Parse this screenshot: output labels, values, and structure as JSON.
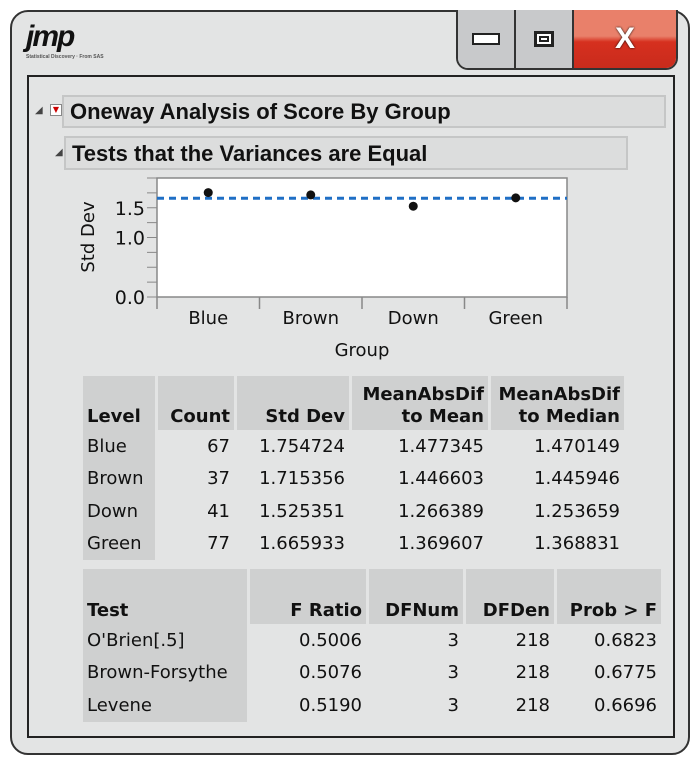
{
  "window": {
    "logo": "jmp",
    "logo_tagline": "Statistical Discovery · From SAS",
    "minimize": "minimize",
    "maximize": "maximize",
    "close": "X"
  },
  "outline": {
    "title": "Oneway Analysis of Score By Group",
    "subtitle": "Tests that the Variances are Equal"
  },
  "chart_data": {
    "type": "scatter",
    "xlabel": "Group",
    "ylabel": "Std Dev",
    "categories": [
      "Blue",
      "Brown",
      "Down",
      "Green"
    ],
    "values": [
      1.754724,
      1.715356,
      1.525351,
      1.665933
    ],
    "ylim": [
      0,
      2
    ],
    "yticks": [
      "0.0",
      "1.0",
      "1.5"
    ],
    "reference_line": 1.66,
    "reference_color": "#1f6fc5",
    "grid": false
  },
  "table1": {
    "headers": [
      "Level",
      "Count",
      "Std Dev",
      "MeanAbsDif to Mean",
      "MeanAbsDif to Median"
    ],
    "rows": [
      [
        "Blue",
        "67",
        "1.754724",
        "1.477345",
        "1.470149"
      ],
      [
        "Brown",
        "37",
        "1.715356",
        "1.446603",
        "1.445946"
      ],
      [
        "Down",
        "41",
        "1.525351",
        "1.266389",
        "1.253659"
      ],
      [
        "Green",
        "77",
        "1.665933",
        "1.369607",
        "1.368831"
      ]
    ]
  },
  "table2": {
    "headers": [
      "Test",
      "F Ratio",
      "DFNum",
      "DFDen",
      "Prob > F"
    ],
    "rows": [
      [
        "O'Brien[.5]",
        "0.5006",
        "3",
        "218",
        "0.6823"
      ],
      [
        "Brown-Forsythe",
        "0.5076",
        "3",
        "218",
        "0.6775"
      ],
      [
        "Levene",
        "0.5190",
        "3",
        "218",
        "0.6696"
      ]
    ]
  }
}
